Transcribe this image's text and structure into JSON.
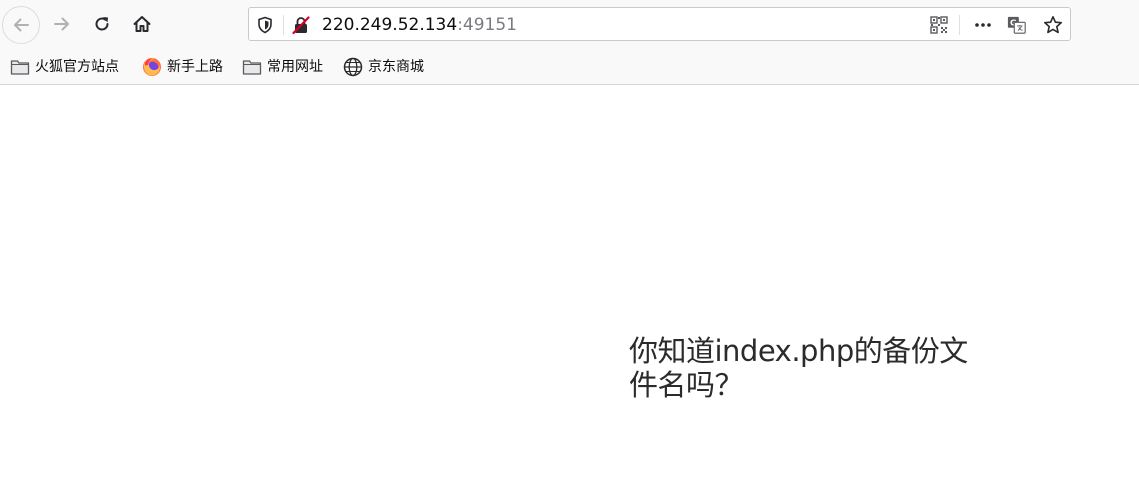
{
  "browser": {
    "url_host": "220.249.52.134",
    "url_port": ":49151",
    "icons": {
      "back": "arrow-left-icon",
      "forward": "arrow-right-icon",
      "reload": "reload-icon",
      "home": "home-icon",
      "tracking": "shield-icon",
      "insecure": "insecure-lock-icon",
      "qr": "qr-code-icon",
      "more": "more-actions-icon",
      "translate": "translate-icon",
      "bookmark_star": "star-icon"
    }
  },
  "bookmarks": [
    {
      "label": "火狐官方站点",
      "icon": "folder-icon"
    },
    {
      "label": "新手上路",
      "icon": "firefox-icon"
    },
    {
      "label": "常用网址",
      "icon": "folder-icon"
    },
    {
      "label": "京东商城",
      "icon": "globe-icon"
    }
  ],
  "page": {
    "message": "你知道index.php的备份文件名吗？"
  },
  "colors": {
    "chrome_bg": "#f9f9fa",
    "text": "#0c0c0d",
    "port_text": "#7a7a80",
    "insecure_red": "#d70022",
    "message_text": "#2b2b2b"
  }
}
